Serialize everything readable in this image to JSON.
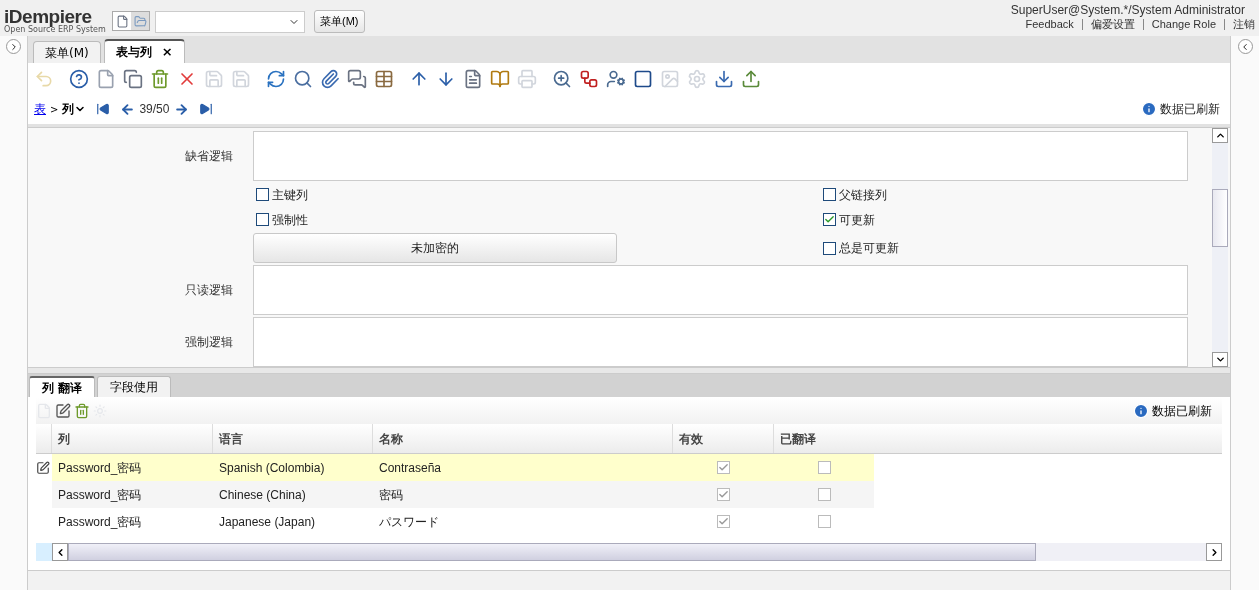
{
  "header": {
    "logo": "iDempiere",
    "logo_tagline": "Open Source ERP System",
    "menu_button": "菜单(M)",
    "user": "SuperUser@System.*/System Administrator",
    "links": [
      "Feedback",
      "偏爱设置",
      "Change Role",
      "注销"
    ]
  },
  "tabs": [
    {
      "label": "菜单(M)",
      "selected": false,
      "closable": false
    },
    {
      "label": "表与列",
      "selected": true,
      "closable": true
    }
  ],
  "close_mark": "×",
  "breadcrumb": {
    "parent": "表",
    "separator": ">",
    "current": "列",
    "record": "39/50",
    "status": "数据已刷新"
  },
  "form": {
    "fields": [
      {
        "kind": "textarea",
        "label": "缺省逻辑"
      },
      {
        "kind": "checks",
        "left": {
          "label": "主键列",
          "checked": false
        },
        "right": {
          "label": "父链接列",
          "checked": false
        }
      },
      {
        "kind": "checks",
        "left": {
          "label": "强制性",
          "checked": false
        },
        "right": {
          "label": "可更新",
          "checked": true
        }
      },
      {
        "kind": "button",
        "button": "未加密的",
        "right": {
          "label": "总是可更新",
          "checked": false
        }
      },
      {
        "kind": "textarea",
        "label": "只读逻辑"
      },
      {
        "kind": "textarea",
        "label": "强制逻辑"
      }
    ]
  },
  "detail": {
    "tabs": [
      {
        "label": "列 翻译",
        "selected": true
      },
      {
        "label": "字段使用",
        "selected": false
      }
    ],
    "status": "数据已刷新",
    "columns": [
      "列",
      "语言",
      "名称",
      "有效",
      "已翻译"
    ],
    "rows": [
      {
        "column": "Password_密码",
        "language": "Spanish (Colombia)",
        "name": "Contraseña",
        "active": true,
        "translated": false,
        "selected": true
      },
      {
        "column": "Password_密码",
        "language": "Chinese (China)",
        "name": "密码",
        "active": true,
        "translated": false,
        "selected": false
      },
      {
        "column": "Password_密码",
        "language": "Japanese (Japan)",
        "name": "パスワード",
        "active": true,
        "translated": false,
        "selected": false
      }
    ]
  }
}
